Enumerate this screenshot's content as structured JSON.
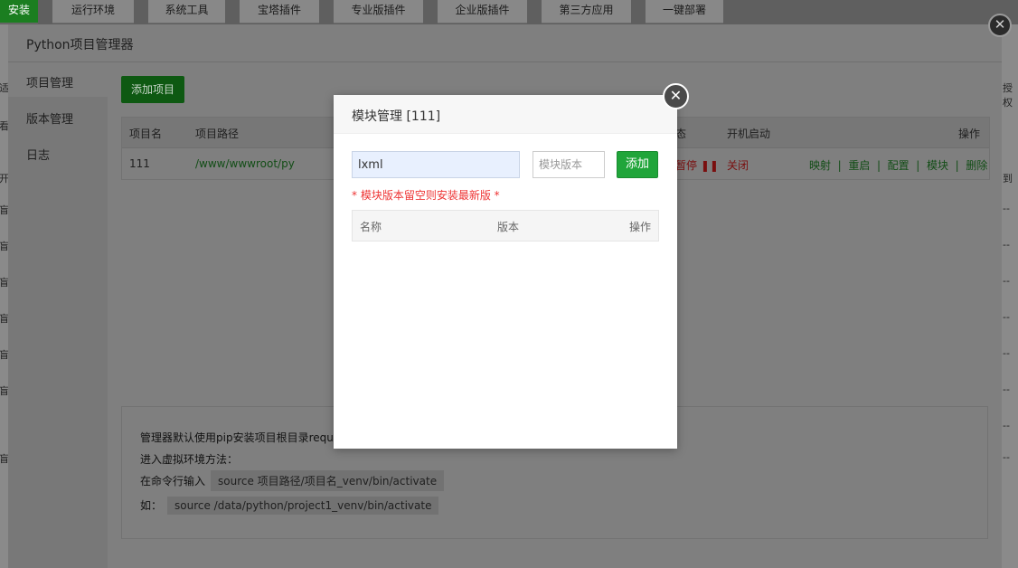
{
  "top_tabs": [
    "安装",
    "运行环境",
    "系统工具",
    "宝塔插件",
    "专业版插件",
    "企业版插件",
    "第三方应用",
    "一键部署"
  ],
  "background": {
    "left_fragments": [
      "适",
      "看",
      "开",
      "盲",
      "盲",
      "盲",
      "盲",
      "盲",
      "盲",
      "盲"
    ],
    "right_fragments": [
      "授权",
      "到",
      "--",
      "--",
      "--",
      "--",
      "--",
      "--",
      "--",
      "--"
    ]
  },
  "manager": {
    "title": "Python项目管理器",
    "sidebar": [
      "项目管理",
      "版本管理",
      "日志"
    ],
    "add_button": "添加项目",
    "table": {
      "headers": [
        "项目名",
        "项目路径",
        "态",
        "开机启动",
        "操作"
      ],
      "row": {
        "name": "111",
        "path": "/www/wwwroot/py",
        "status": "暂停",
        "status_icon": "pause-icon",
        "boot": "关闭",
        "actions": [
          "映射",
          "重启",
          "配置",
          "模块",
          "删除"
        ]
      }
    },
    "info": {
      "line1": "管理器默认使用pip安装项目根目录requ",
      "line2": "进入虚拟环境方法：",
      "line3_label": "在命令行输入",
      "line3_code": "source 项目路径/项目名_venv/bin/activate",
      "line4_label": "如：",
      "line4_code": "source /data/python/project1_venv/bin/activate"
    }
  },
  "modal": {
    "title": "模块管理 [111]",
    "module_name_value": "lxml",
    "module_version_placeholder": "模块版本",
    "add_button": "添加",
    "hint": "* 模块版本留空则安装最新版 *",
    "table_headers": [
      "名称",
      "版本",
      "操作"
    ]
  },
  "colors": {
    "accent_green": "#20a53a",
    "link_green": "#20a53a",
    "danger_red": "#e33"
  }
}
